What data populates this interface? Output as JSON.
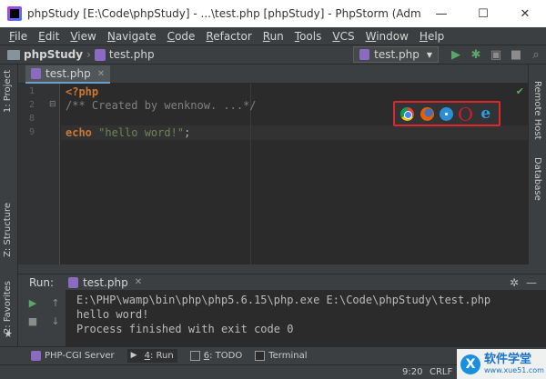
{
  "window": {
    "title": "phpStudy [E:\\Code\\phpStudy] - ...\\test.php [phpStudy] - PhpStorm (Administrator)",
    "minimize": "—",
    "maximize": "☐",
    "close": "✕"
  },
  "menu": [
    "File",
    "Edit",
    "View",
    "Navigate",
    "Code",
    "Refactor",
    "Run",
    "Tools",
    "VCS",
    "Window",
    "Help"
  ],
  "navbar": {
    "project": "phpStudy",
    "file": "test.php",
    "run_config": "test.php"
  },
  "left_tools": {
    "project": "1: Project",
    "structure": "Z: Structure",
    "favorites": "2: Favorites"
  },
  "right_tools": {
    "remote_host": "Remote Host",
    "database": "Database"
  },
  "editor": {
    "tab": "test.php",
    "line_numbers": [
      "1",
      "2",
      "8",
      "9"
    ],
    "lines": {
      "l1": "<?php",
      "l2": "/** Created by wenknow. ...*/",
      "l9_kw": "echo",
      "l9_str": " \"hello word!\"",
      "l9_end": ";"
    },
    "browsers": [
      "chrome-icon",
      "firefox-icon",
      "safari-icon",
      "opera-icon",
      "ie-icon"
    ],
    "ie_glyph": "e"
  },
  "run_panel": {
    "label": "Run:",
    "tab": "test.php",
    "console": [
      "E:\\PHP\\wamp\\bin\\php\\php5.6.15\\php.exe E:\\Code\\phpStudy\\test.php",
      "hello word!",
      "Process finished with exit code 0"
    ]
  },
  "bottom_tools": {
    "php_cgi": "PHP-CGI Server",
    "run_num": "4",
    "run_label": ": Run",
    "todo_num": "6",
    "todo_label": ": TODO",
    "terminal": "Terminal"
  },
  "status": {
    "position": "9:20",
    "line_ending": "CRLF"
  },
  "watermark": {
    "glyph": "X",
    "name": "软件学堂",
    "url": "www.xue51.com"
  },
  "colors": {
    "accent_red": "#e0262d",
    "run_green": "#59a869",
    "keyword": "#cc7832",
    "string": "#6a8759",
    "comment": "#808080"
  }
}
